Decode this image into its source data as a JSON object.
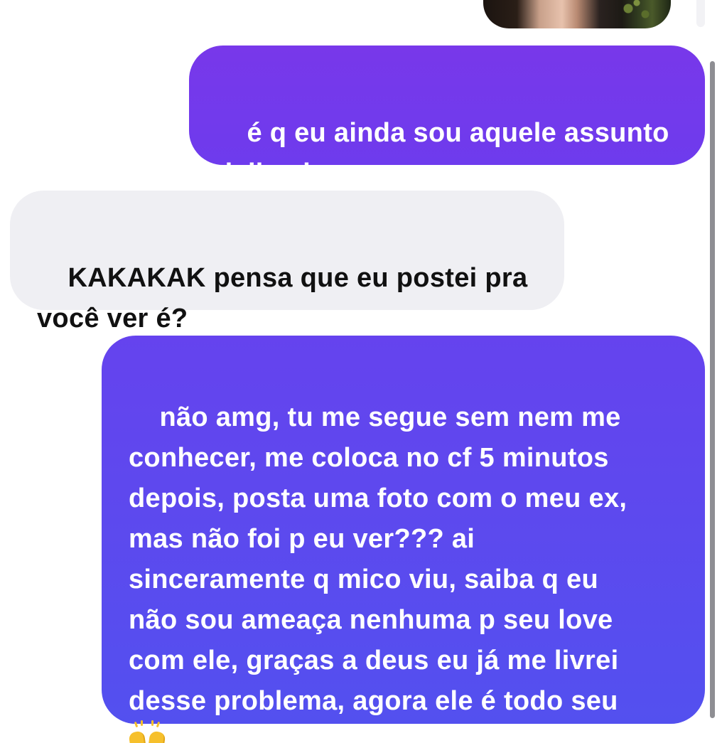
{
  "conversation": {
    "messages": [
      {
        "direction": "sent",
        "text": "é q eu ainda sou aquele assunto\ndelicado..."
      },
      {
        "direction": "received",
        "text": "KAKAKAK pensa que eu postei pra\nvocê ver é?"
      },
      {
        "direction": "sent",
        "text": "não amg, tu me segue sem nem me\nconhecer, me coloca no cf 5 minutos\ndepois, posta uma foto com o meu ex,\nmas não foi p eu ver??? ai\nsinceramente q mico viu, saiba q eu\nnão sou ameaça nenhuma p seu love\ncom ele, graças a deus eu já me livrei\ndesse problema, agora ele é todo seu\n",
        "emoji": "raising-hands-icon"
      }
    ]
  },
  "colors": {
    "sent_bubble_top": "#7838ea",
    "sent_bubble_bottom": "#5350ef",
    "received_bubble": "#efeff3",
    "sent_text": "#ffffff",
    "received_text": "#111111",
    "scrollbar": "#8e8e93"
  }
}
